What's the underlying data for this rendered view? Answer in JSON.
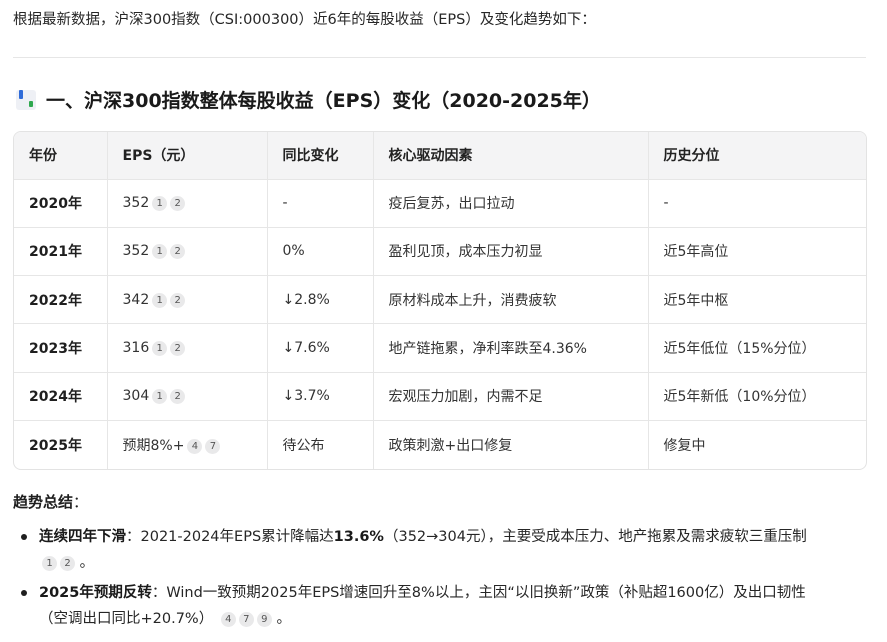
{
  "intro": "根据最新数据，沪深300指数（CSI:000300）近6年的每股收益（EPS）及变化趋势如下：",
  "section": {
    "title": "一、沪深300指数整体每股收益（EPS）变化（2020-2025年）",
    "icon": "bar-chart-icon"
  },
  "table": {
    "headers": [
      "年份",
      "EPS（元）",
      "同比变化",
      "核心驱动因素",
      "历史分位"
    ],
    "rows": [
      {
        "year": "2020年",
        "eps": "352",
        "cites": [
          "1",
          "2"
        ],
        "change": "-",
        "driver": "疫后复苏，出口拉动",
        "percentile": "-"
      },
      {
        "year": "2021年",
        "eps": "352",
        "cites": [
          "1",
          "2"
        ],
        "change": "0%",
        "driver": "盈利见顶，成本压力初显",
        "percentile": "近5年高位"
      },
      {
        "year": "2022年",
        "eps": "342",
        "cites": [
          "1",
          "2"
        ],
        "change": "↓2.8%",
        "driver": "原材料成本上升，消费疲软",
        "percentile": "近5年中枢"
      },
      {
        "year": "2023年",
        "eps": "316",
        "cites": [
          "1",
          "2"
        ],
        "change": "↓7.6%",
        "driver": "地产链拖累，净利率跌至4.36%",
        "percentile": "近5年低位（15%分位）"
      },
      {
        "year": "2024年",
        "eps": "304",
        "cites": [
          "1",
          "2"
        ],
        "change": "↓3.7%",
        "driver": "宏观压力加剧，内需不足",
        "percentile": "近5年新低（10%分位）"
      },
      {
        "year": "2025年",
        "eps": "预期8%+",
        "cites": [
          "4",
          "7"
        ],
        "change": "待公布",
        "driver": "政策刺激+出口修复",
        "percentile": "修复中"
      }
    ]
  },
  "summary": {
    "title": "趋势总结",
    "colon": "：",
    "items": [
      {
        "bold": "连续四年下滑",
        "text_before": "：2021-2024年EPS累计降幅达",
        "highlight": "13.6%",
        "text_after": "（352→304元），主要受成本压力、地产拖累及需求疲软三重压制",
        "cites": [
          "1",
          "2"
        ],
        "end": "。"
      },
      {
        "bold": "2025年预期反转",
        "text_before": "：Wind一致预期2025年EPS增速回升至8%以上，主因“以旧换新”政策（补贴超1600亿）及出口韧性",
        "text_line2": "（空调出口同比+20.7%）",
        "cites": [
          "4",
          "7",
          "9"
        ],
        "end": "。"
      }
    ]
  }
}
